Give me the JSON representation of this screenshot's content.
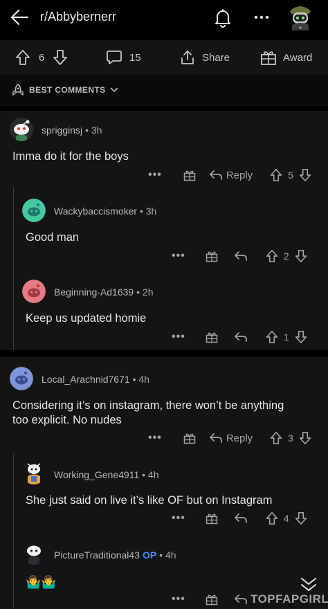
{
  "header": {
    "subreddit": "r/Abbybernerr",
    "icons": [
      "back-arrow-icon",
      "bell-icon",
      "more-icon",
      "user-avatar-icon"
    ]
  },
  "post_actions": {
    "vote_count": "6",
    "comment_count": "15",
    "share_label": "Share",
    "award_label": "Award"
  },
  "sort": {
    "label": "BEST COMMENTS"
  },
  "comments": [
    {
      "username": "spriggins​j",
      "time": "3h",
      "body": "Imma do it for the boys",
      "votes": "5",
      "reply_label": "Reply",
      "replies": [
        {
          "username": "Wackybaccismoker",
          "time": "3h",
          "body": "Good man",
          "votes": "2"
        },
        {
          "username": "Beginning-Ad1639",
          "time": "2h",
          "body": "Keep us updated homie",
          "votes": "1"
        }
      ]
    },
    {
      "username": "Local_Arachnid7671",
      "time": "4h",
      "body_line1": "Considering it’s on instagram, there won’t be anything",
      "body_line2": "too explicit. No nudes",
      "votes": "3",
      "reply_label": "Reply",
      "replies": [
        {
          "username": "Working_Gene4911",
          "time": "4h",
          "body": "She just said on live it’s like OF but on Instagram",
          "votes": "4"
        },
        {
          "username": "PictureTraditional43",
          "op_badge": "OP",
          "time": "4h",
          "body": "🤷‍♂️🤷‍♂️",
          "votes": ""
        }
      ]
    }
  ],
  "meta_separator": "•",
  "more_dots": "•••",
  "watermark": "TOPFAPGIRLS",
  "colors": {
    "background": "#000000",
    "card": "#141415",
    "text": "#e4e6e7",
    "muted": "#a7abad",
    "op_badge": "#3d8bfd",
    "avatar_green": "#45c9a5",
    "avatar_pink": "#e57a84",
    "avatar_blue": "#7d96d8"
  }
}
